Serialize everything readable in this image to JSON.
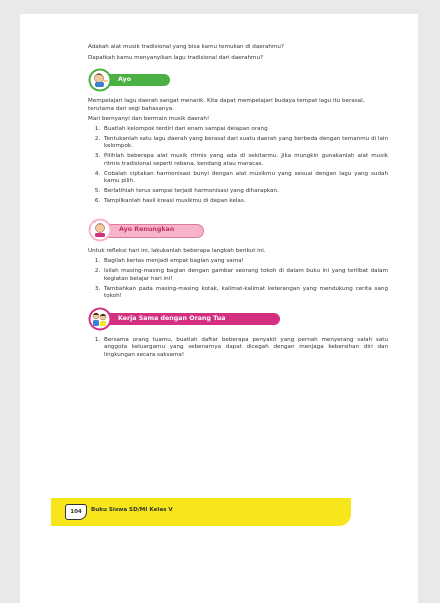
{
  "intro": [
    "Adakah alat musik tradisional yang bisa kamu temukan di daerahmu?",
    "Dapatkah kamu menyanyikan lagu tradisional dari daerahmu?"
  ],
  "ayo_lakukan": {
    "title": "Ayo Lakukan",
    "paragraph1": "Mempelajari lagu daerah sangat menarik. Kita dapat mempelajari budaya tempat lagu itu berasal, terutama dari segi bahasanya.",
    "paragraph2": "Mari bernyanyi dan bermain musik daerah!",
    "steps": [
      "Buatlah kelompok terdiri dari enam sampai delapan orang",
      "Tentukanlah satu lagu daerah yang berasal dari suatu daerah yang berbeda dengan temanmu di lain kelompok.",
      "Pilihlah beberapa alat musik ritmis yang ada di sekitarmu. Jika mungkin gunakanlah alat musik ritmis tradisional seperti rebana, kendang atau maracas.",
      "Cobalah ciptakan harmonisasi bunyi dengan alat musikmu yang sesuai dengan lagu yang sudah kamu pilih.",
      "Berlatihlah terus sampai terjadi harmonisasi yang diharapkan.",
      "Tampilkanlah hasil kreasi musikmu di depan kelas."
    ]
  },
  "ayo_renungkan": {
    "title": "Ayo Renungkan",
    "paragraph": "Untuk refleksi hari ini, lakukanlah beberapa langkah berikut ini.",
    "steps": [
      "Bagilah kertas menjadi empat bagian yang sama!",
      "Isilah masing-masing bagian dengan gambar seorang tokoh di dalam buku ini yang terlibat dalam kegiatan belajar hari ini!",
      "Tambahkan pada masing-masing kotak, kalimat-kalimat keterangan yang mendukung cerita sang tokoh!"
    ]
  },
  "kerja_sama": {
    "title": "Kerja Sama dengan Orang Tua",
    "steps": [
      "Bersama orang tuamu, buatlah daftar beberapa penyakit yang pernah menyerang salah satu anggota keluargamu yang sebenarnya dapat dicegah dengan menjaga kebersihan diri dan lingkungan secara saksama!"
    ]
  },
  "footer": {
    "page_number": "104",
    "book_title": "Buku Siswa SD/MI Kelas V"
  },
  "colors": {
    "green": "#49b041",
    "pink": "#f7b3c8",
    "magenta": "#d52f82",
    "yellow": "#f7e61c"
  }
}
